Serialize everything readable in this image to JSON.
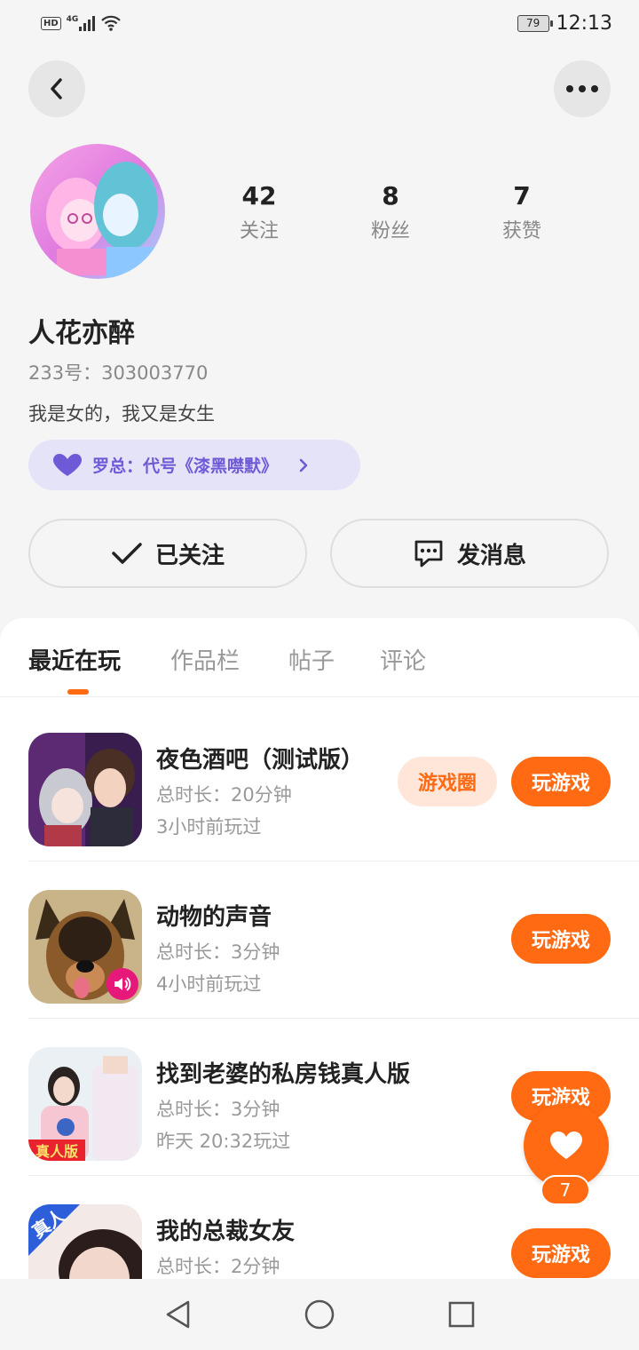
{
  "status_bar": {
    "network": "HD",
    "signal_label": "4G",
    "battery": "79",
    "time": "12:13"
  },
  "header": {
    "back_icon": "chevron-left-icon",
    "more_icon": "more-dots-icon"
  },
  "profile": {
    "stats": [
      {
        "num": "42",
        "label": "关注"
      },
      {
        "num": "8",
        "label": "粉丝"
      },
      {
        "num": "7",
        "label": "获赞"
      }
    ],
    "name": "人花亦醉",
    "uid": "233号：303003770",
    "bio": "我是女的，我又是女生",
    "tag": "罗总：代号《漆黑噤默》",
    "follow_label": "已关注",
    "message_label": "发消息"
  },
  "tabs": [
    "最近在玩",
    "作品栏",
    "帖子",
    "评论"
  ],
  "games": [
    {
      "title": "夜色酒吧（测试版）",
      "duration": "总时长：20分钟",
      "last": "3小时前玩过",
      "circle": "游戏圈",
      "play": "玩游戏"
    },
    {
      "title": "动物的声音",
      "duration": "总时长：3分钟",
      "last": "4小时前玩过",
      "play": "玩游戏"
    },
    {
      "title": "找到老婆的私房钱真人版",
      "duration": "总时长：3分钟",
      "last": "昨天 20:32玩过",
      "badge": "真人版",
      "play": "玩游戏"
    },
    {
      "title": "我的总裁女友",
      "duration": "总时长：2分钟",
      "badge": "真人",
      "play": "玩游戏"
    }
  ],
  "like": {
    "count": "7"
  },
  "colors": {
    "accent": "#ff6a13",
    "tag_bg": "#e5e3f8",
    "tag_text": "#6e5ad6"
  }
}
